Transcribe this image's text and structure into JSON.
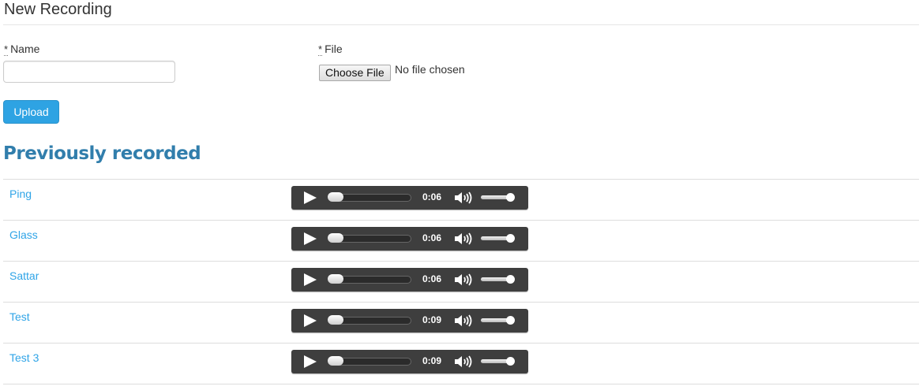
{
  "form": {
    "title": "New Recording",
    "required_mark": "*",
    "name_label": "Name",
    "name_value": "",
    "file_label": "File",
    "choose_file_label": "Choose File",
    "no_file_text": "No file chosen",
    "upload_label": "Upload"
  },
  "recordings_section": {
    "heading": "Previously recorded",
    "items": [
      {
        "name": "Ping",
        "duration": "0:06"
      },
      {
        "name": "Glass",
        "duration": "0:06"
      },
      {
        "name": "Sattar",
        "duration": "0:06"
      },
      {
        "name": "Test",
        "duration": "0:09"
      },
      {
        "name": "Test 3",
        "duration": "0:09"
      }
    ]
  },
  "colors": {
    "link": "#2fa4e7",
    "heading": "#317eac",
    "upload_button": "#2ea3e3",
    "player_bg": "#3e3e3e"
  }
}
